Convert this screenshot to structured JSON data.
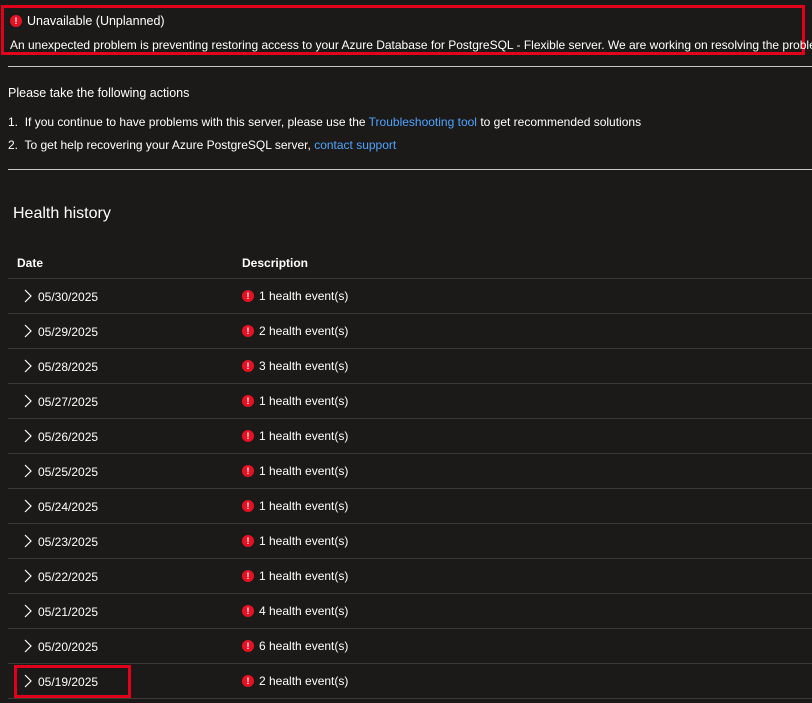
{
  "banner": {
    "title": "Unavailable (Unplanned)",
    "description": "An unexpected problem is preventing restoring access to your Azure Database for PostgreSQL - Flexible server. We are working on resolving the problem.",
    "icon": "error-icon",
    "icon_glyph": "!"
  },
  "actions": {
    "heading": "Please take the following actions",
    "items": [
      {
        "number": "1.",
        "prefix": "If you continue to have problems with this server, please use the",
        "link": "Troubleshooting tool",
        "suffix": "to get recommended solutions"
      },
      {
        "number": "2.",
        "prefix": "To get help recovering your Azure PostgreSQL server,",
        "link": "contact support",
        "suffix": ""
      }
    ]
  },
  "health_history": {
    "title": "Health history",
    "columns": {
      "date": "Date",
      "description": "Description"
    },
    "rows": [
      {
        "date": "05/30/2025",
        "description": "1 health event(s)"
      },
      {
        "date": "05/29/2025",
        "description": "2 health event(s)"
      },
      {
        "date": "05/28/2025",
        "description": "3 health event(s)"
      },
      {
        "date": "05/27/2025",
        "description": "1 health event(s)"
      },
      {
        "date": "05/26/2025",
        "description": "1 health event(s)"
      },
      {
        "date": "05/25/2025",
        "description": "1 health event(s)"
      },
      {
        "date": "05/24/2025",
        "description": "1 health event(s)"
      },
      {
        "date": "05/23/2025",
        "description": "1 health event(s)"
      },
      {
        "date": "05/22/2025",
        "description": "1 health event(s)"
      },
      {
        "date": "05/21/2025",
        "description": "4 health event(s)"
      },
      {
        "date": "05/20/2025",
        "description": "6 health event(s)"
      },
      {
        "date": "05/19/2025",
        "description": "2 health event(s)"
      }
    ]
  },
  "colors": {
    "background": "#1b1a19",
    "error": "#e81123",
    "highlight_border": "#e0001b",
    "link": "#4fa3ff"
  }
}
